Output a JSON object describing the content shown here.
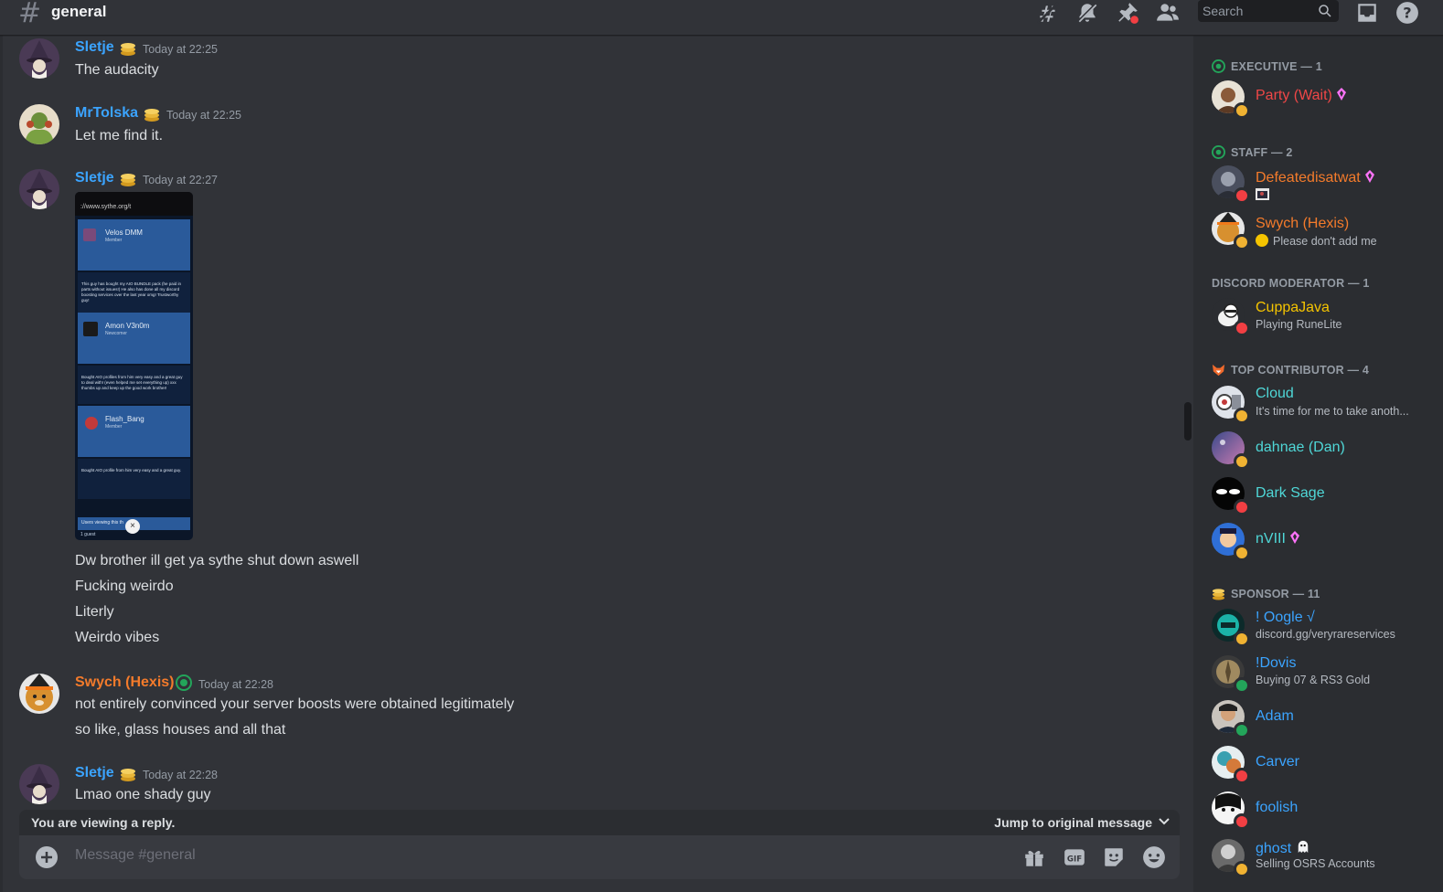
{
  "header": {
    "channel": "general",
    "search_placeholder": "Search"
  },
  "messages": [
    {
      "author": "Sletje",
      "time": "Today at 22:25",
      "lines": [
        "The audacity"
      ]
    },
    {
      "author": "MrTolska",
      "time": "Today at 22:25",
      "lines": [
        "Let me find it."
      ]
    },
    {
      "author": "Sletje",
      "time": "Today at 22:27",
      "lines": [
        "Dw brother ill get ya sythe shut down aswell",
        "Fucking weirdo",
        "Literly",
        "Weirdo vibes"
      ]
    },
    {
      "author": "Swych (Hexis)",
      "time": "Today at 22:28",
      "lines": [
        "not entirely convinced your server boosts were obtained legitimately",
        "so like, glass houses and all that"
      ]
    },
    {
      "author": "Sletje",
      "time": "Today at 22:28",
      "lines": [
        "Lmao one shady guy"
      ]
    }
  ],
  "attachment": {
    "url": "://www.sythe.org/t",
    "entries": [
      {
        "name": "Velos DMM",
        "role": "Member",
        "vouch": "This guy has bought my AIO BUNDLE pack (he paid in parts without issues!) He also has done all my discord boosting services over the last year omg! Trustworthy guy!"
      },
      {
        "name": "Amon V3n0m",
        "role": "Newcomer",
        "vouch": "Bought AIO profiles from him very easy and a great guy to deal with! (even helped me set everything up) xxx thumbs up and keep up the good work brother!"
      },
      {
        "name": "Flash_Bang",
        "role": "Member",
        "vouch": "Bought AIO profile from him very easy and a great guy."
      }
    ],
    "footer": "Users viewing this th",
    "guests": "1 guest"
  },
  "reply_bar": {
    "left": "You are viewing a reply.",
    "right": "Jump to original message"
  },
  "composer": {
    "placeholder": "Message #general"
  },
  "members": {
    "groups": [
      {
        "title": "EXECUTIVE — 1",
        "members": [
          {
            "name": "Party (Wait)",
            "color": "#f04747",
            "status_color": "#f0b232",
            "status_text": "",
            "booster": true
          }
        ]
      },
      {
        "title": "STAFF — 2",
        "members": [
          {
            "name": "Defeatedisatwat",
            "color": "#f47b2b",
            "status_color": "#f23f43",
            "status_text": "",
            "booster": true
          },
          {
            "name": "Swych (Hexis)",
            "color": "#f47b2b",
            "status_color": "#f0b232",
            "status_text": "Please don't add me",
            "booster": false
          }
        ]
      },
      {
        "title": "DISCORD MODERATOR — 1",
        "members": [
          {
            "name": "CuppaJava",
            "color": "#f5c400",
            "status_color": "#f23f43",
            "status_text": "Playing RuneLite",
            "booster": false
          }
        ]
      },
      {
        "title": "TOP CONTRIBUTOR — 4",
        "members": [
          {
            "name": "Cloud",
            "color": "#4fd7d7",
            "status_color": "#f0b232",
            "status_text": "It's time for me to take anoth...",
            "booster": false
          },
          {
            "name": "dahnae (Dan)",
            "color": "#4fd7d7",
            "status_color": "#f0b232",
            "status_text": "",
            "booster": false
          },
          {
            "name": "Dark Sage",
            "color": "#4fd7d7",
            "status_color": "#f23f43",
            "status_text": "",
            "booster": false
          },
          {
            "name": "nVIII",
            "color": "#4fd7d7",
            "status_color": "#f0b232",
            "status_text": "",
            "booster": true
          }
        ]
      },
      {
        "title": "SPONSOR — 11",
        "members": [
          {
            "name": "! Oogle √",
            "color": "#3ba4ff",
            "status_color": "#f0b232",
            "status_text": "discord.gg/veryrareservices",
            "booster": false
          },
          {
            "name": "!Dovis",
            "color": "#3ba4ff",
            "status_color": "#23a55a",
            "status_text": "Buying 07 & RS3 Gold",
            "booster": false
          },
          {
            "name": "Adam",
            "color": "#3ba4ff",
            "status_color": "#23a55a",
            "status_text": "",
            "booster": false
          },
          {
            "name": "Carver",
            "color": "#3ba4ff",
            "status_color": "#f23f43",
            "status_text": "",
            "booster": false
          },
          {
            "name": "foolish",
            "color": "#3ba4ff",
            "status_color": "#f23f43",
            "status_text": "",
            "booster": false
          },
          {
            "name": "ghost",
            "color": "#3ba4ff",
            "status_color": "#f0b232",
            "status_text": "Selling OSRS Accounts",
            "booster": false
          }
        ]
      }
    ]
  },
  "colors": {
    "sletje": "#3ba4ff",
    "mrtolska": "#3ba4ff",
    "swych": "#f47b2b",
    "background": "#313338",
    "sidebar": "#2b2d31"
  }
}
